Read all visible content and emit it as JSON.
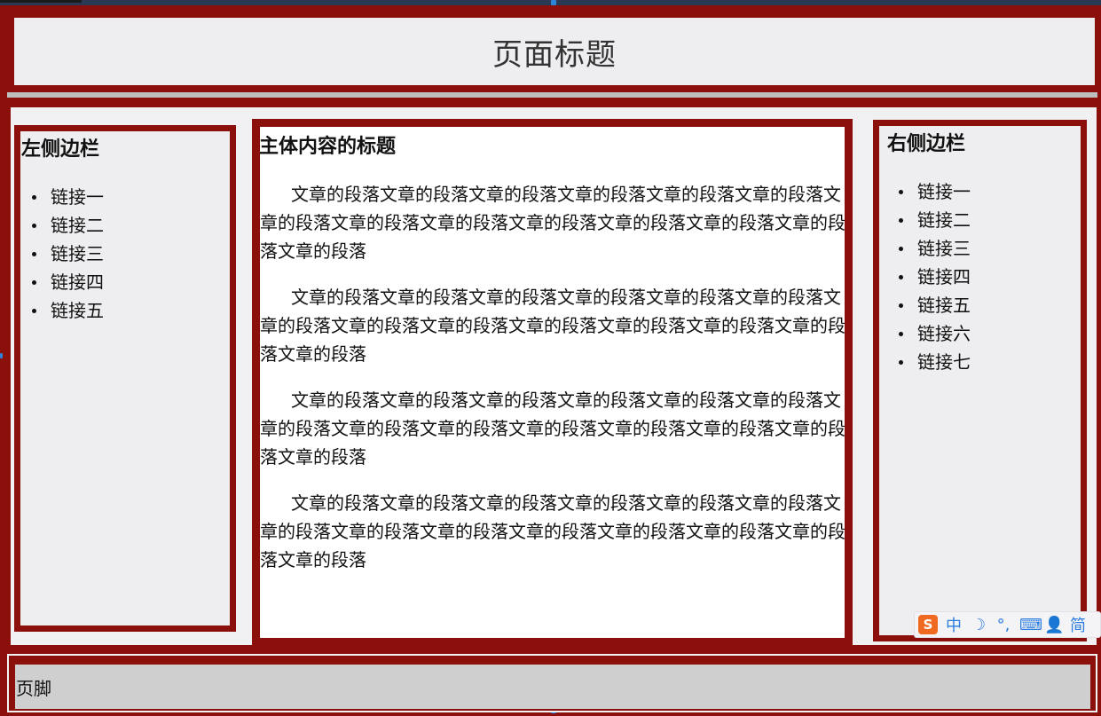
{
  "page": {
    "header_title": "页面标题",
    "footer_text": "页脚"
  },
  "left_sidebar": {
    "title": "左侧边栏",
    "links": [
      "链接一",
      "链接二",
      "链接三",
      "链接四",
      "链接五"
    ]
  },
  "main": {
    "title": "主体内容的标题",
    "paragraphs": [
      "文章的段落文章的段落文章的段落文章的段落文章的段落文章的段落文章的段落文章的段落文章的段落文章的段落文章的段落文章的段落文章的段落文章的段落",
      "文章的段落文章的段落文章的段落文章的段落文章的段落文章的段落文章的段落文章的段落文章的段落文章的段落文章的段落文章的段落文章的段落文章的段落",
      "文章的段落文章的段落文章的段落文章的段落文章的段落文章的段落文章的段落文章的段落文章的段落文章的段落文章的段落文章的段落文章的段落文章的段落",
      "文章的段落文章的段落文章的段落文章的段落文章的段落文章的段落文章的段落文章的段落文章的段落文章的段落文章的段落文章的段落文章的段落文章的段落"
    ]
  },
  "right_sidebar": {
    "title": "右侧边栏",
    "links": [
      "链接一",
      "链接二",
      "链接三",
      "链接四",
      "链接五",
      "链接六",
      "链接七"
    ]
  },
  "ime_toolbar": {
    "logo": "S",
    "mode": "中",
    "moon": "☽",
    "punct": "°,",
    "keyboard": "⌨",
    "user": "👤",
    "simplified": "简"
  },
  "colors": {
    "frame": "#8b0f0a",
    "panel": "#eeedf0",
    "main_bg": "#ffffff",
    "footer_bg": "#cfcfcf",
    "ime_accent": "#2b7de0",
    "ime_logo": "#ef6a20"
  }
}
